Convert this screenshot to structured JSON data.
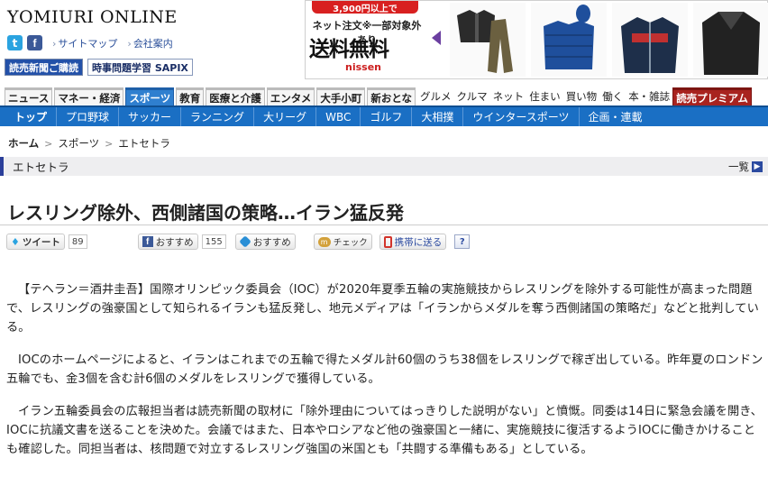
{
  "header": {
    "logo": "YOMIURI ONLINE",
    "social": {
      "twitter_icon": "t",
      "facebook_icon": "f"
    },
    "links": [
      "サイトマップ",
      "会社案内"
    ],
    "buttons": [
      "読売新聞ご購読",
      "時事問題学習 SAPIX"
    ]
  },
  "ad": {
    "tag": "3,900円以上で",
    "sub": "ネット注文※一部対象外あり",
    "main": "送料無料",
    "brand": "nissen",
    "products": [
      "jacket-and-pants",
      "down-jacket",
      "zip-hoodie",
      "coat"
    ]
  },
  "main_nav": {
    "tabs": [
      "ニュース",
      "マネー・経済",
      "スポーツ",
      "教育",
      "医療と介護",
      "エンタメ",
      "大手小町",
      "新おとな"
    ],
    "active": "スポーツ",
    "links": [
      "グルメ",
      "クルマ",
      "ネット",
      "住まい",
      "買い物",
      "働く",
      "本・雑誌"
    ],
    "premium": "読売プレミアム"
  },
  "sub_nav": {
    "items": [
      "トップ",
      "プロ野球",
      "サッカー",
      "ランニング",
      "大リーグ",
      "WBC",
      "ゴルフ",
      "大相撲",
      "ウインタースポーツ",
      "企画・連載"
    ]
  },
  "breadcrumb": [
    "ホーム",
    "スポーツ",
    "エトセトラ"
  ],
  "section": {
    "title": "エトセトラ",
    "more": "一覧"
  },
  "article": {
    "title": "レスリング除外、西側諸国の策略…イラン猛反発",
    "share": {
      "tweet": "ツイート",
      "tweet_count": "89",
      "fb_like": "おすすめ",
      "fb_count": "155",
      "recommend": "おすすめ",
      "mixi": "チェック",
      "mobile": "携帯に送る",
      "help": "?"
    },
    "paragraphs": [
      "【テヘラン＝酒井圭吾】国際オリンピック委員会（IOC）が2020年夏季五輪の実施競技からレスリングを除外する可能性が高まった問題で、レスリングの強豪国として知られるイランも猛反発し、地元メディアは「イランからメダルを奪う西側諸国の策略だ」などと批判している。",
      "IOCのホームページによると、イランはこれまでの五輪で得たメダル計60個のうち38個をレスリングで稼ぎ出している。昨年夏のロンドン五輪でも、金3個を含む計6個のメダルをレスリングで獲得している。",
      "イラン五輪委員会の広報担当者は読売新聞の取材に「除外理由についてはっきりした説明がない」と憤慨。同委は14日に緊急会議を開き、IOCに抗議文書を送ることを決めた。会議ではまた、日本やロシアなど他の強豪国と一緒に、実施競技に復活するようIOCに働きかけることも確認した。同担当者は、核問題で対立するレスリング強国の米国とも「共闘する準備もある」としている。"
    ]
  }
}
